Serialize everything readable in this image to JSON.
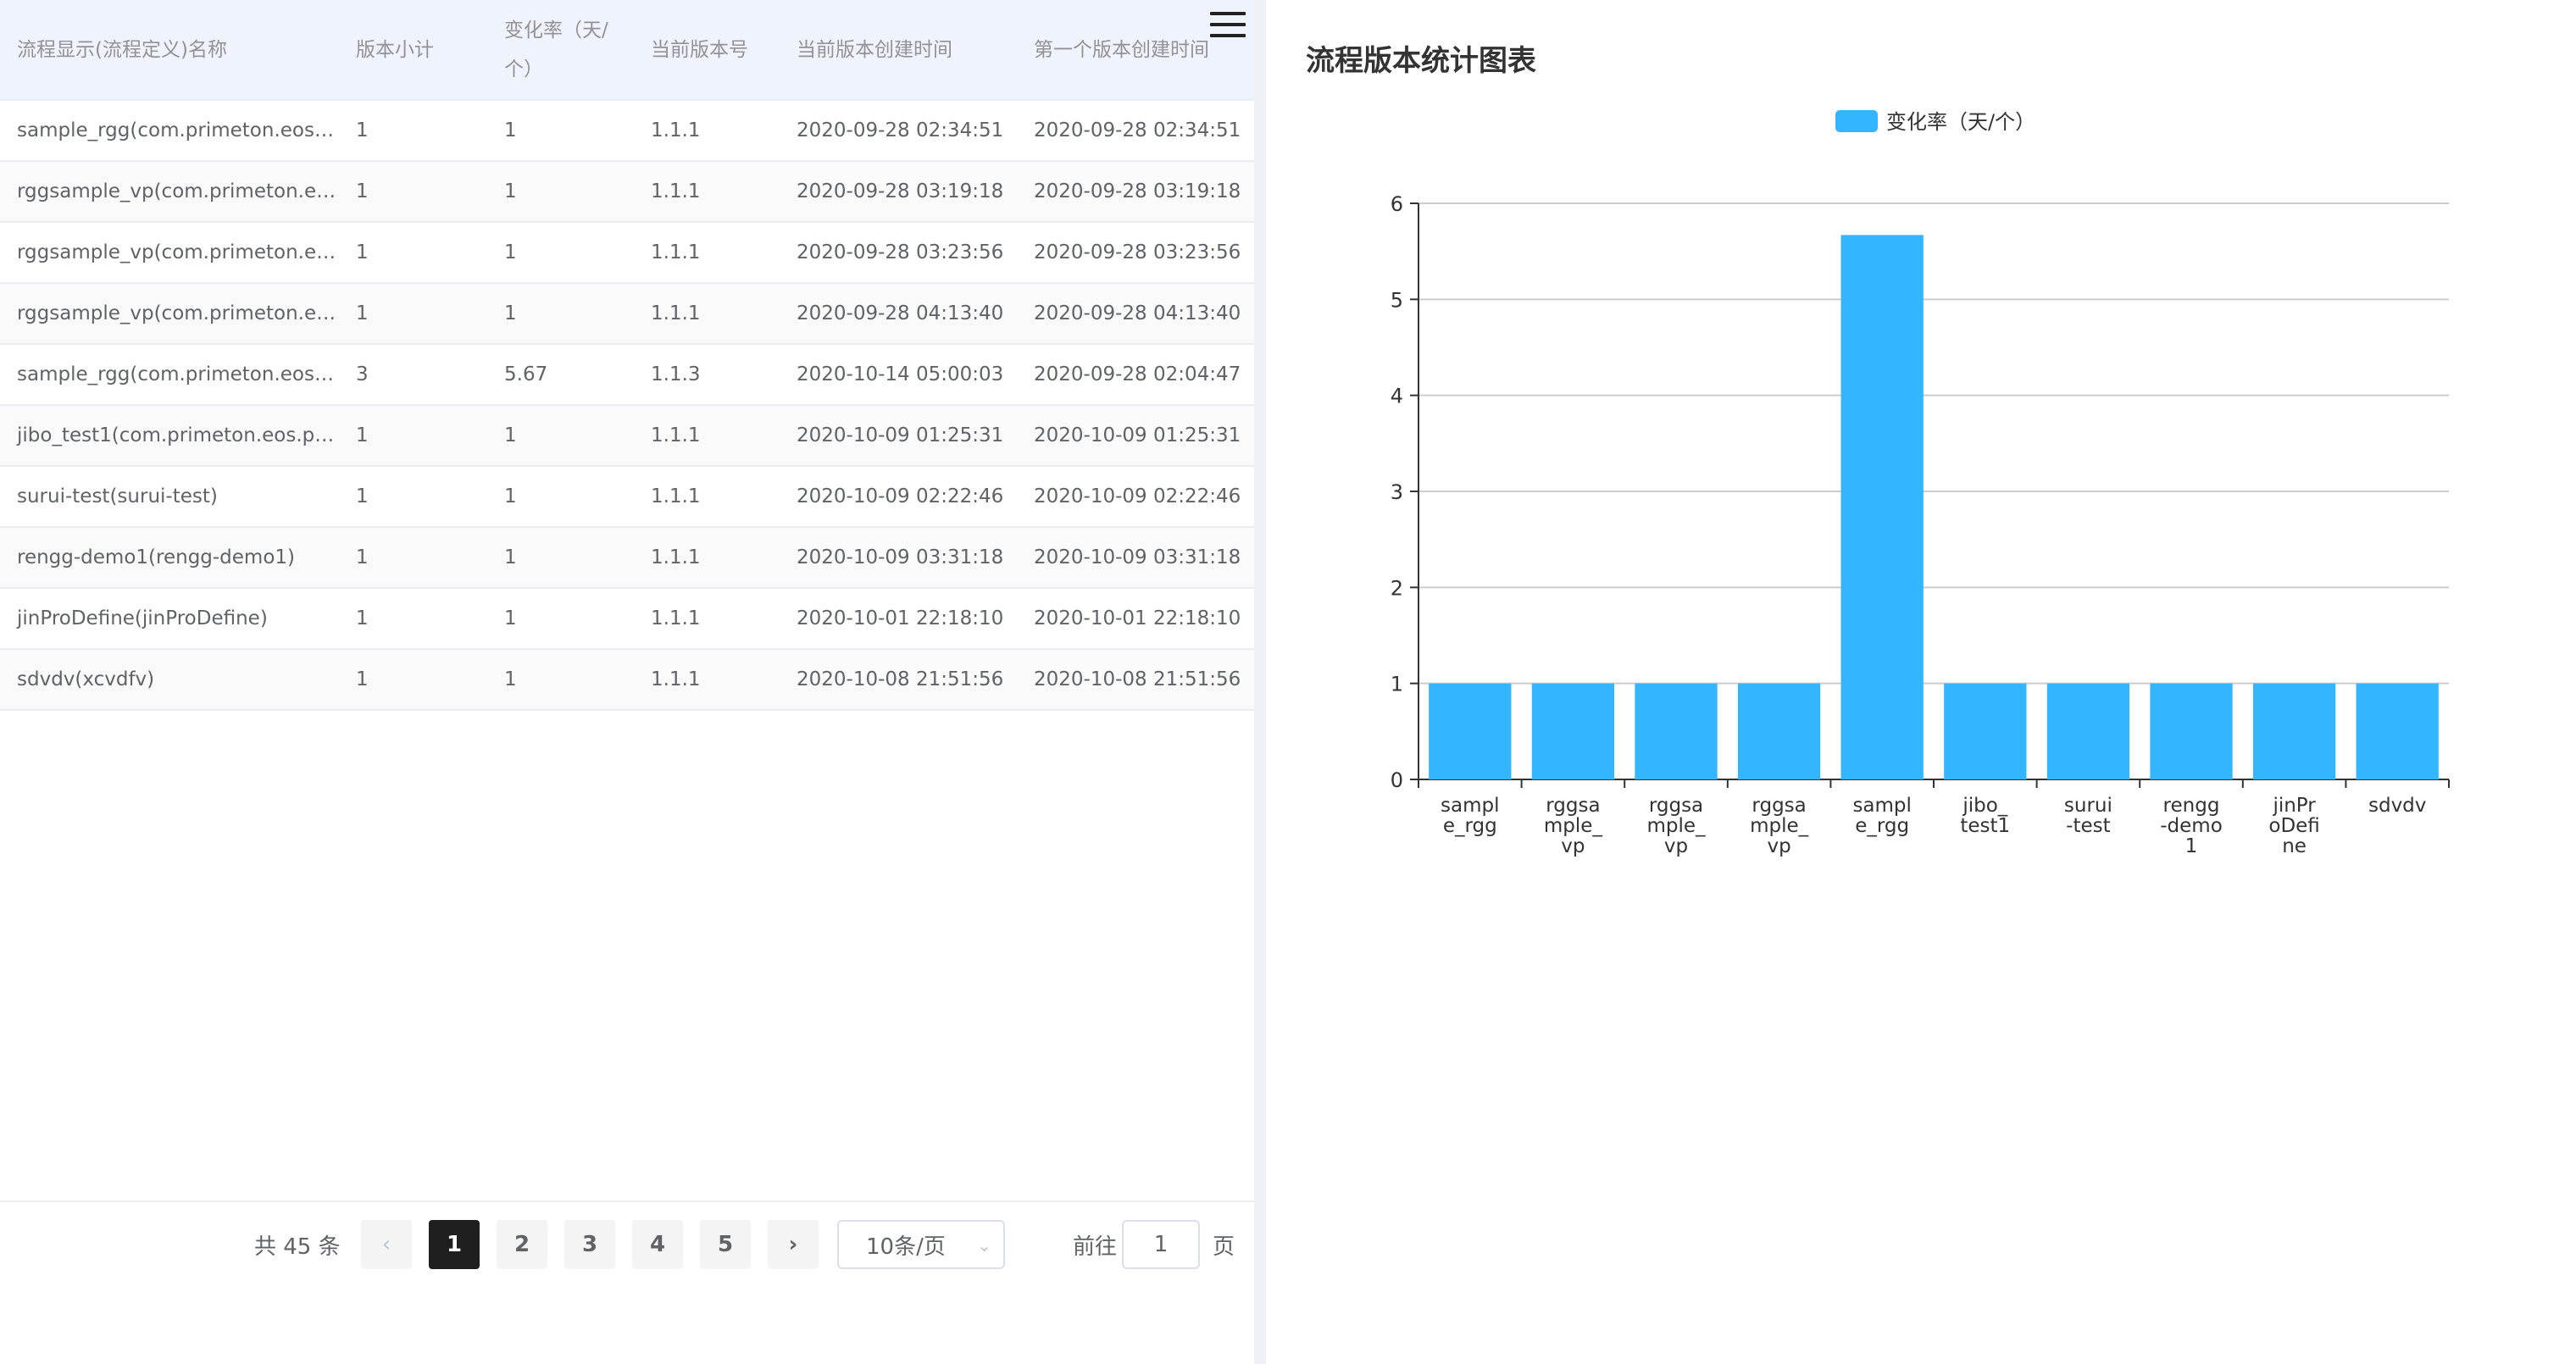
{
  "table": {
    "headers": [
      "流程显示(流程定义)名称",
      "版本小计",
      "变化率（天/个）",
      "当前版本号",
      "当前版本创建时间",
      "第一个版本创建时间"
    ],
    "header_rate_line1": "变化率（天/",
    "header_rate_line2": "个）",
    "rows": [
      {
        "name": "sample_rgg(com.primeton.eos.…",
        "count": "1",
        "rate": "1",
        "version": "1.1.1",
        "current_time": "2020-09-28 02:34:51",
        "first_time": "2020-09-28 02:34:51"
      },
      {
        "name": "rggsample_vp(com.primeton.e…",
        "count": "1",
        "rate": "1",
        "version": "1.1.1",
        "current_time": "2020-09-28 03:19:18",
        "first_time": "2020-09-28 03:19:18"
      },
      {
        "name": "rggsample_vp(com.primeton.e…",
        "count": "1",
        "rate": "1",
        "version": "1.1.1",
        "current_time": "2020-09-28 03:23:56",
        "first_time": "2020-09-28 03:23:56"
      },
      {
        "name": "rggsample_vp(com.primeton.e…",
        "count": "1",
        "rate": "1",
        "version": "1.1.1",
        "current_time": "2020-09-28 04:13:40",
        "first_time": "2020-09-28 04:13:40"
      },
      {
        "name": "sample_rgg(com.primeton.eos.…",
        "count": "3",
        "rate": "5.67",
        "version": "1.1.3",
        "current_time": "2020-10-14 05:00:03",
        "first_time": "2020-09-28 02:04:47"
      },
      {
        "name": "jibo_test1(com.primeton.eos.pr…",
        "count": "1",
        "rate": "1",
        "version": "1.1.1",
        "current_time": "2020-10-09 01:25:31",
        "first_time": "2020-10-09 01:25:31"
      },
      {
        "name": "surui-test(surui-test)",
        "count": "1",
        "rate": "1",
        "version": "1.1.1",
        "current_time": "2020-10-09 02:22:46",
        "first_time": "2020-10-09 02:22:46"
      },
      {
        "name": "rengg-demo1(rengg-demo1)",
        "count": "1",
        "rate": "1",
        "version": "1.1.1",
        "current_time": "2020-10-09 03:31:18",
        "first_time": "2020-10-09 03:31:18"
      },
      {
        "name": "jinProDefine(jinProDefine)",
        "count": "1",
        "rate": "1",
        "version": "1.1.1",
        "current_time": "2020-10-01 22:18:10",
        "first_time": "2020-10-01 22:18:10"
      },
      {
        "name": "sdvdv(xcvdfv)",
        "count": "1",
        "rate": "1",
        "version": "1.1.1",
        "current_time": "2020-10-08 21:51:56",
        "first_time": "2020-10-08 21:51:56"
      }
    ]
  },
  "pagination": {
    "total": "共 45 条",
    "prev": "‹",
    "pages": [
      "1",
      "2",
      "3",
      "4",
      "5"
    ],
    "active_page": "1",
    "next": "›",
    "page_size": "10条/页",
    "jump_prefix": "前往",
    "jump_value": "1",
    "jump_suffix": "页"
  },
  "icons": {
    "menu": "hamburger-menu-icon"
  },
  "chart_title": "流程版本统计图表",
  "chart_data": {
    "type": "bar",
    "legend": [
      "变化率（天/个）"
    ],
    "legend_position": "top-center",
    "categories": [
      "sample_rgg",
      "rggsample_vp",
      "rggsample_vp",
      "rggsample_vp",
      "sample_rgg",
      "jibo_test1",
      "surui-test",
      "rengg-demo1",
      "jinProDefine",
      "sdvdv"
    ],
    "category_label_lines": [
      [
        "sampl",
        "e_rgg"
      ],
      [
        "rggsa",
        "mple_",
        "vp"
      ],
      [
        "rggsa",
        "mple_",
        "vp"
      ],
      [
        "rggsa",
        "mple_",
        "vp"
      ],
      [
        "sampl",
        "e_rgg"
      ],
      [
        "jibo_",
        "test1"
      ],
      [
        "surui",
        "-test"
      ],
      [
        "rengg",
        "-demo",
        "1"
      ],
      [
        "jinPr",
        "oDefi",
        "ne"
      ],
      [
        "sdvdv"
      ]
    ],
    "series": [
      {
        "name": "变化率（天/个）",
        "values": [
          1,
          1,
          1,
          1,
          5.67,
          1,
          1,
          1,
          1,
          1
        ]
      }
    ],
    "ylim": [
      0,
      6
    ],
    "yticks": [
      0,
      1,
      2,
      3,
      4,
      5,
      6
    ],
    "grid": true,
    "bar_color": "#33b5ff"
  }
}
